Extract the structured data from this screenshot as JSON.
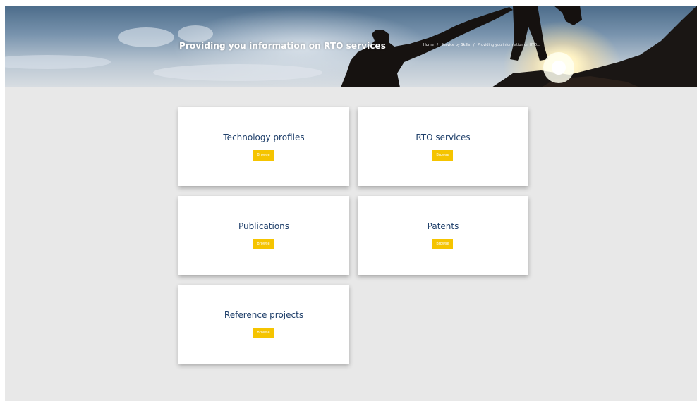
{
  "hero": {
    "title": "Providing you information on RTO services",
    "breadcrumb": [
      "Home",
      "Service by Skills",
      "Providing you information on RTO..."
    ]
  },
  "cards": [
    {
      "title": "Technology profiles",
      "button": "Browse"
    },
    {
      "title": "RTO services",
      "button": "Browse"
    },
    {
      "title": "Publications",
      "button": "Browse"
    },
    {
      "title": "Patents",
      "button": "Browse"
    },
    {
      "title": "Reference projects",
      "button": "Browse"
    }
  ],
  "colors": {
    "page_bg": "#e8e8e8",
    "card_title": "#1f3f6a",
    "button_bg": "#f5c400",
    "button_text": "#ffffff"
  }
}
